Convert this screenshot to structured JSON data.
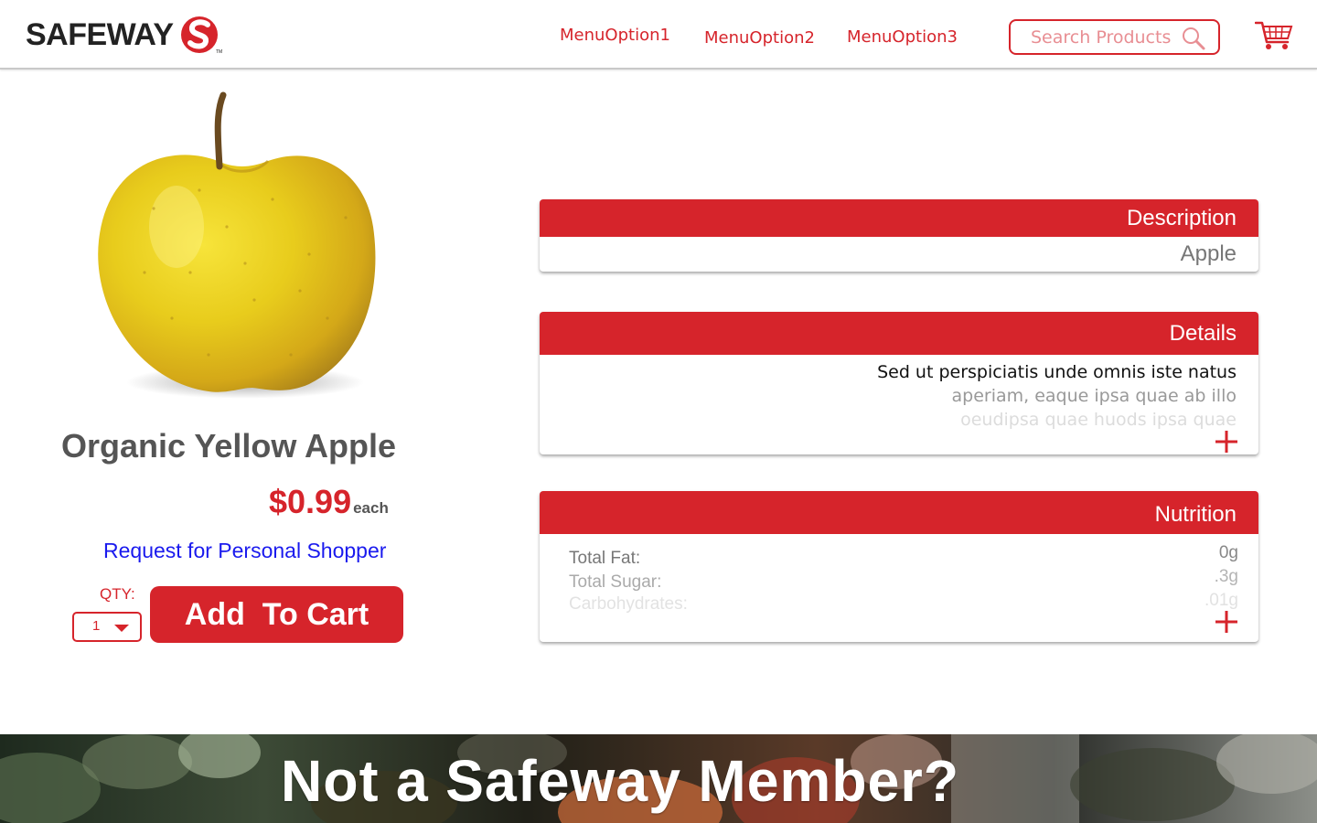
{
  "brand": {
    "name": "SAFEWAY",
    "trademark": "TM",
    "color": "#d6242b"
  },
  "nav": {
    "items": [
      {
        "label": "MenuOption1"
      },
      {
        "label": "MenuOption2"
      },
      {
        "label": "MenuOption3"
      }
    ]
  },
  "search": {
    "placeholder": "Search Products",
    "icon": "magnifier-icon"
  },
  "cart": {
    "icon": "shopping-cart-icon"
  },
  "product": {
    "name": "Organic Yellow Apple",
    "price": "$0.99",
    "price_unit": "each",
    "shopper_link": "Request for Personal Shopper",
    "qty_label": "QTY:",
    "qty_value": "1",
    "add_to_cart": "Add  To Cart"
  },
  "description": {
    "title": "Description",
    "text": "Apple"
  },
  "details": {
    "title": "Details",
    "lines": [
      "Sed ut perspiciatis unde omnis iste natus",
      "aperiam, eaque ipsa quae ab illo",
      "oeudipsa quae huods ipsa quae"
    ]
  },
  "nutrition": {
    "title": "Nutrition",
    "rows": [
      {
        "label": "Total Fat:",
        "value": "0g"
      },
      {
        "label": "Total Sugar:",
        "value": ".3g"
      },
      {
        "label": "Carbohydrates:",
        "value": ".01g"
      }
    ]
  },
  "banner": {
    "title": "Not a Safeway Member?"
  }
}
